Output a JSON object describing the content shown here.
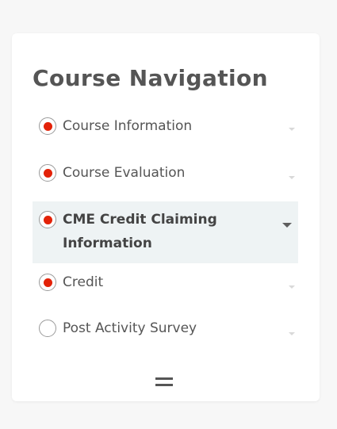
{
  "nav": {
    "title": "Course Navigation",
    "items": [
      {
        "label": "Course Information",
        "checked": true,
        "active": false
      },
      {
        "label": "Course Evaluation",
        "checked": true,
        "active": false
      },
      {
        "label": "CME Credit Claiming Information",
        "checked": true,
        "active": true
      },
      {
        "label": "Credit",
        "checked": true,
        "active": false
      },
      {
        "label": "Post Activity Survey",
        "checked": false,
        "active": false
      }
    ]
  },
  "icons": {
    "radio_checked": "radio-checked-icon",
    "radio_unchecked": "radio-unchecked-icon",
    "expand": "chevron-down-icon",
    "menu": "hamburger-menu-icon"
  },
  "colors": {
    "radio_dot": "#e32208",
    "active_row": "#eef3f4",
    "text": "#555555"
  }
}
